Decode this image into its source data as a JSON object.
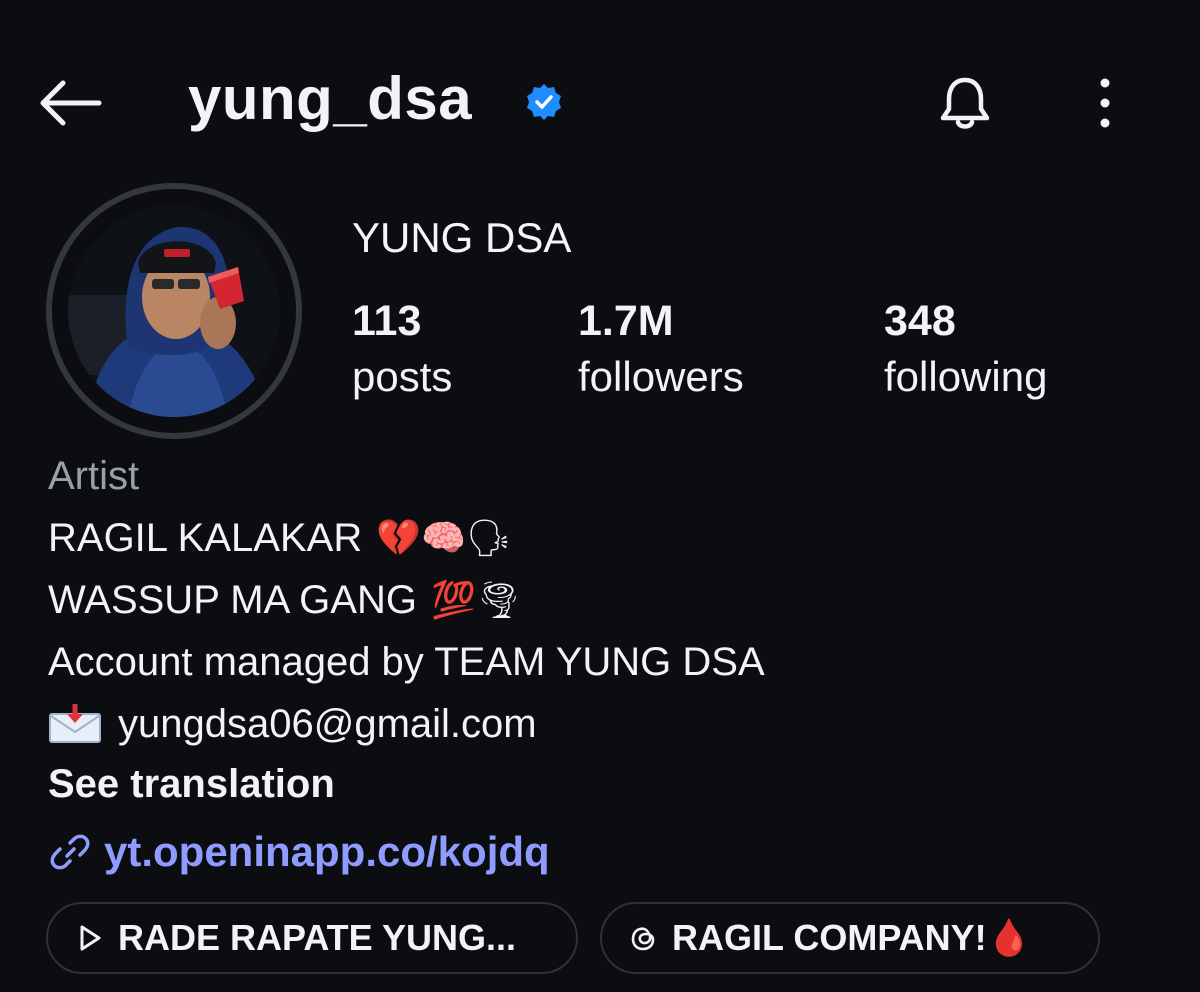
{
  "header": {
    "username": "yung_dsa",
    "back_icon": "arrow-left-icon",
    "verified_icon": "verified-badge-icon",
    "bell_icon": "bell-icon",
    "more_icon": "more-vertical-icon"
  },
  "profile": {
    "display_name": "YUNG DSA",
    "stats": {
      "posts_count": "113",
      "posts_label": "posts",
      "followers_count": "1.7M",
      "followers_label": "followers",
      "following_count": "348",
      "following_label": "following"
    },
    "bio": {
      "category": "Artist",
      "line1_text": "RAGIL KALAKAR",
      "line1_emoji": "💔🧠🗣",
      "line2_text": "WASSUP MA GANG",
      "line2_emoji": "💯🌪",
      "line3_text": "Account managed by TEAM YUNG DSA",
      "email_text": "yungdsa06@gmail.com",
      "see_translation": "See translation"
    },
    "link": {
      "text": "yt.openinapp.co/kojdq",
      "icon": "link-icon"
    }
  },
  "chips": [
    {
      "label": "RADE RAPATE  YUNG...",
      "icon": "play-icon"
    },
    {
      "label": "RAGIL COMPANY!🩸",
      "icon": "threads-icon"
    }
  ],
  "colors": {
    "background": "#0b0d10",
    "text": "#f2f3f5",
    "secondary_text": "#9aa0a6",
    "link": "#8f9bff",
    "verified": "#1f8cff",
    "chip_border": "#2e3137"
  }
}
